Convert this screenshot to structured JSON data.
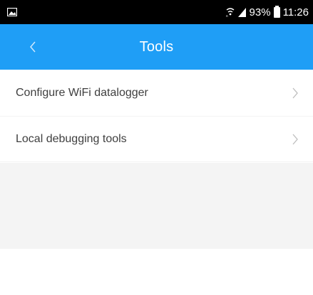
{
  "status_bar": {
    "battery": "93%",
    "time": "11:26",
    "icons": [
      "gallery-icon",
      "wifi-icon",
      "signal-icon",
      "battery-icon"
    ]
  },
  "app_bar": {
    "title": "Tools",
    "back_icon": "chevron-left-icon",
    "color": "#1f9ef6"
  },
  "menu": {
    "items": [
      {
        "label": "Configure WiFi datalogger",
        "icon": "chevron-right-icon"
      },
      {
        "label": "Local debugging tools",
        "icon": "chevron-right-icon"
      }
    ]
  }
}
